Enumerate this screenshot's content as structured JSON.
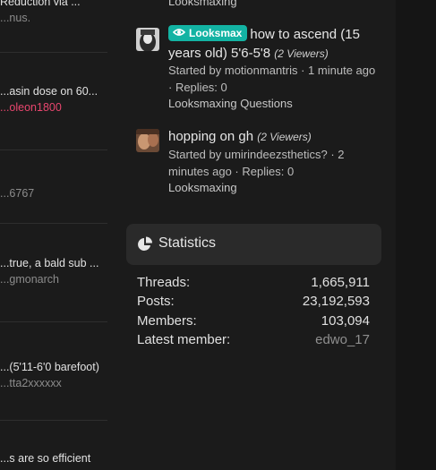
{
  "left_list": [
    {
      "title": "Reduction via ...",
      "sub": "...nus.",
      "sub_style": "muted"
    },
    {
      "title": "...asin dose on 60...",
      "sub": "...oleon1800",
      "sub_style": "pink"
    },
    {
      "title": "",
      "sub": "...6767",
      "sub_style": "muted"
    },
    {
      "title": "...true, a bald sub ...",
      "sub": "...gmonarch",
      "sub_style": "muted"
    },
    {
      "title": "...(5'11-6'0 barefoot)",
      "sub": "...tta2xxxxxx",
      "sub_style": "muted"
    },
    {
      "title": "...s are so efficient",
      "sub": "",
      "sub_style": "muted"
    }
  ],
  "threads": [
    {
      "top_forum": "Looksmaxing"
    },
    {
      "badge": "Looksmax",
      "title": "how to ascend (15 years old) 5'6-5'8",
      "viewers": "(2 Viewers)",
      "meta": "Started by motionmantris · 1 minute ago · Replies: 0",
      "forum": "Looksmaxing Questions"
    },
    {
      "title": "hopping on gh",
      "viewers": "(2 Viewers)",
      "meta": "Started by umirindeezsthetics? · 2 minutes ago · Replies: 0",
      "forum": "Looksmaxing"
    }
  ],
  "statistics": {
    "title": "Statistics",
    "rows": [
      {
        "label": "Threads:",
        "value": "1,665,911"
      },
      {
        "label": "Posts:",
        "value": "23,192,593"
      },
      {
        "label": "Members:",
        "value": "103,094"
      },
      {
        "label": "Latest member:",
        "value": "edwo_17"
      }
    ]
  },
  "icons": {
    "badge_icon": "eye-icon",
    "stats_icon": "pie-chart-icon"
  },
  "colors": {
    "badge": "#13b3a3",
    "username_pink": "#e8466e"
  }
}
